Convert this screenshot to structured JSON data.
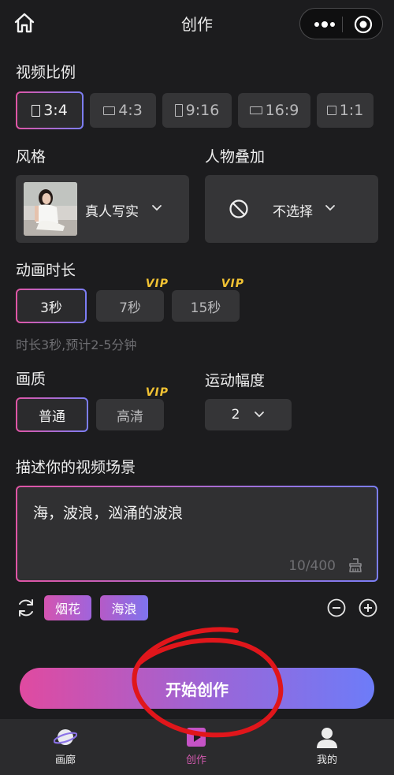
{
  "header": {
    "title": "创作"
  },
  "ratio": {
    "label": "视频比例",
    "options": [
      "3:4",
      "4:3",
      "9:16",
      "16:9",
      "1:1"
    ],
    "selected": "3:4"
  },
  "style": {
    "label": "风格",
    "value": "真人写实"
  },
  "person": {
    "label": "人物叠加",
    "value": "不选择"
  },
  "duration": {
    "label": "动画时长",
    "options": [
      "3秒",
      "7秒",
      "15秒"
    ],
    "vip_badge": "VIP",
    "hint": "时长3秒,预计2-5分钟"
  },
  "quality": {
    "label": "画质",
    "options": [
      "普通",
      "高清"
    ],
    "vip_badge": "VIP"
  },
  "motion": {
    "label": "运动幅度",
    "value": "2"
  },
  "scene": {
    "label": "描述你的视频场景",
    "text": "海，波浪，汹涌的波浪",
    "counter": "10/400"
  },
  "tags": [
    "烟花",
    "海浪"
  ],
  "start_button": "开始创作",
  "tabbar": {
    "gallery": "画廊",
    "create": "创作",
    "me": "我的"
  },
  "colors": {
    "accent_pink": "#e055a5",
    "accent_blue": "#7b7ef6",
    "vip": "#f1c233",
    "annotation_red": "#e0161b"
  }
}
